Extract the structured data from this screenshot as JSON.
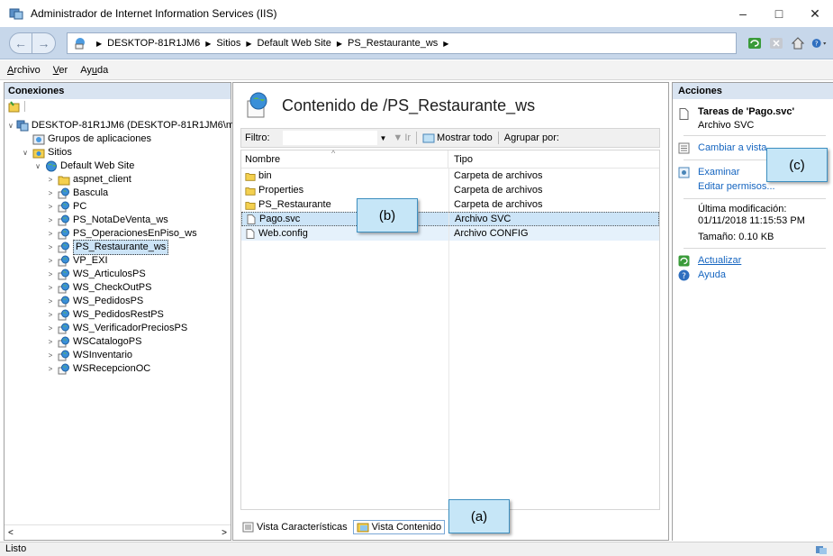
{
  "window": {
    "title": "Administrador de Internet Information Services (IIS)",
    "controls": [
      "–",
      "□",
      "✕"
    ]
  },
  "address": {
    "crumbs": [
      "DESKTOP-81R1JM6",
      "Sitios",
      "Default Web Site",
      "PS_Restaurante_ws"
    ]
  },
  "menu": {
    "items": [
      {
        "pre": "",
        "u": "A",
        "post": "rchivo"
      },
      {
        "pre": "",
        "u": "V",
        "post": "er"
      },
      {
        "pre": "Ay",
        "u": "u",
        "post": "da"
      }
    ]
  },
  "connections": {
    "header": "Conexiones",
    "tree": [
      {
        "label": "DESKTOP-81R1JM6 (DESKTOP-81R1JM6\\m",
        "depth": 0,
        "exp": "∨",
        "icon": "server-icon"
      },
      {
        "label": "Grupos de aplicaciones",
        "depth": 1,
        "exp": "",
        "icon": "app-pools-icon"
      },
      {
        "label": "Sitios",
        "depth": 1,
        "exp": "∨",
        "icon": "sites-folder-icon"
      },
      {
        "label": "Default Web Site",
        "depth": 2,
        "exp": "∨",
        "icon": "globe-icon"
      },
      {
        "label": "aspnet_client",
        "depth": 3,
        "exp": ">",
        "icon": "folder-icon"
      },
      {
        "label": "Bascula",
        "depth": 3,
        "exp": ">",
        "icon": "web-app-icon"
      },
      {
        "label": "PC",
        "depth": 3,
        "exp": ">",
        "icon": "web-app-icon"
      },
      {
        "label": "PS_NotaDeVenta_ws",
        "depth": 3,
        "exp": ">",
        "icon": "web-app-icon"
      },
      {
        "label": "PS_OperacionesEnPiso_ws",
        "depth": 3,
        "exp": ">",
        "icon": "web-app-icon"
      },
      {
        "label": "PS_Restaurante_ws",
        "depth": 3,
        "exp": ">",
        "icon": "web-app-icon",
        "selected": true
      },
      {
        "label": "VP_EXI",
        "depth": 3,
        "exp": ">",
        "icon": "web-app-icon"
      },
      {
        "label": "WS_ArticulosPS",
        "depth": 3,
        "exp": ">",
        "icon": "web-app-icon"
      },
      {
        "label": "WS_CheckOutPS",
        "depth": 3,
        "exp": ">",
        "icon": "web-app-icon"
      },
      {
        "label": "WS_PedidosPS",
        "depth": 3,
        "exp": ">",
        "icon": "web-app-icon"
      },
      {
        "label": "WS_PedidosRestPS",
        "depth": 3,
        "exp": ">",
        "icon": "web-app-icon"
      },
      {
        "label": "WS_VerificadorPreciosPS",
        "depth": 3,
        "exp": ">",
        "icon": "web-app-icon"
      },
      {
        "label": "WSCatalogoPS",
        "depth": 3,
        "exp": ">",
        "icon": "web-app-icon"
      },
      {
        "label": "WSInventario",
        "depth": 3,
        "exp": ">",
        "icon": "web-app-icon"
      },
      {
        "label": "WSRecepcionOC",
        "depth": 3,
        "exp": ">",
        "icon": "web-app-icon"
      }
    ]
  },
  "content": {
    "title": "Contenido de /PS_Restaurante_ws",
    "filter_label": "Filtro:",
    "go_label": "Ir",
    "show_all": "Mostrar todo",
    "group_by": "Agrupar por:",
    "col_name": "Nombre",
    "col_type": "Tipo",
    "rows": [
      {
        "name": "bin",
        "type": "Carpeta de archivos",
        "icon": "folder-icon"
      },
      {
        "name": "Properties",
        "type": "Carpeta de archivos",
        "icon": "folder-icon"
      },
      {
        "name": "PS_Restaurante",
        "type": "Carpeta de archivos",
        "icon": "folder-icon"
      },
      {
        "name": "Pago.svc",
        "type": "Archivo SVC",
        "icon": "file-icon",
        "selected": true
      },
      {
        "name": "Web.config",
        "type": "Archivo CONFIG",
        "icon": "file-icon",
        "hover": true
      }
    ],
    "tab_features": "Vista Características",
    "tab_content": "Vista Contenido"
  },
  "actions": {
    "header": "Acciones",
    "tasks_title": "Tareas de 'Pago.svc'",
    "tasks_sub": "Archivo SVC",
    "switch_view": "Cambiar a vista",
    "explore": "Examinar",
    "edit_perms": "Editar permisos...",
    "modified_label": "Última modificación:",
    "modified_value": "01/11/2018 11:15:53 PM",
    "size": "Tamaño: 0.10 KB",
    "refresh": "Actualizar",
    "help": "Ayuda"
  },
  "status": {
    "text": "Listo"
  },
  "callouts": {
    "a": "(a)",
    "b": "(b)",
    "c": "(c)"
  }
}
